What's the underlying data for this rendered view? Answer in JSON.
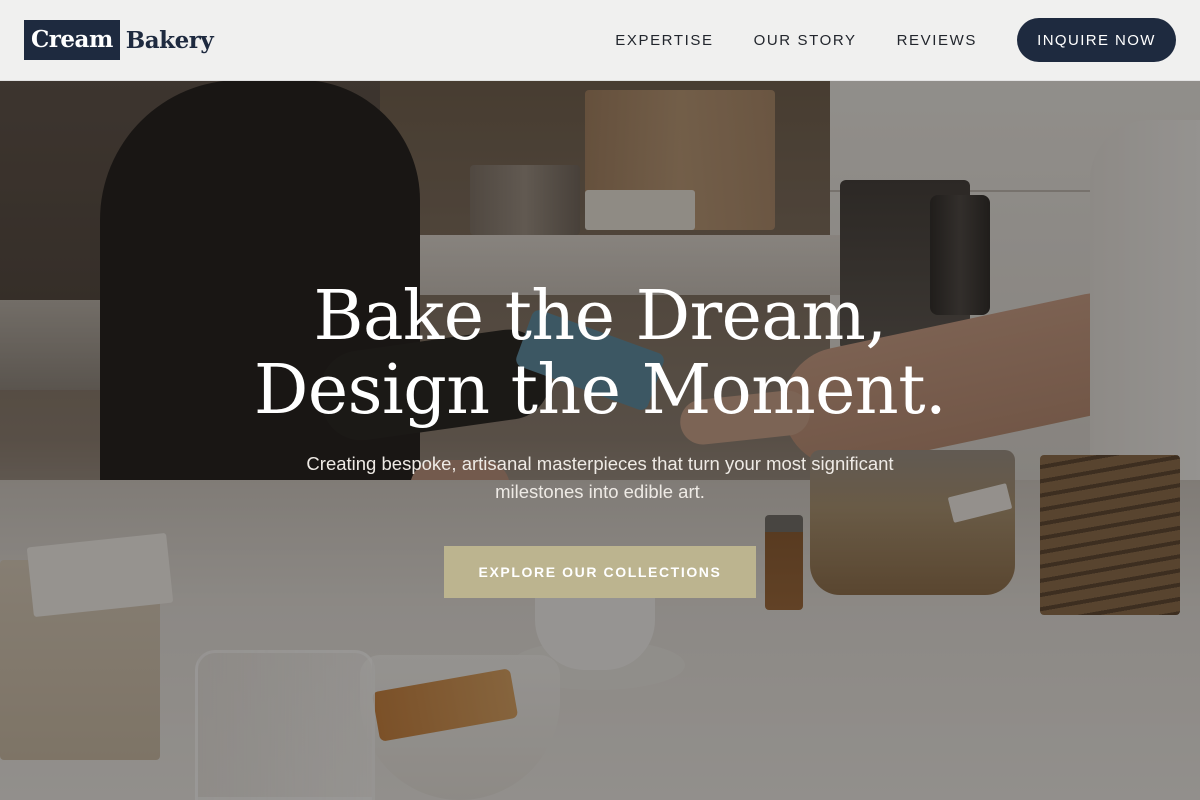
{
  "nav": {
    "logo_highlight": "Cream",
    "logo_word": "Bakery",
    "links": [
      {
        "label": "EXPERTISE"
      },
      {
        "label": "OUR STORY"
      },
      {
        "label": "REVIEWS"
      }
    ],
    "inquire_label": "INQUIRE NOW"
  },
  "hero": {
    "headline_line1": "Bake the Dream,",
    "headline_line2": "Design the Moment.",
    "subtitle": "Creating bespoke, artisanal masterpieces that turn your most significant milestones into edible art.",
    "cta_label": "EXPLORE OUR COLLECTIONS"
  },
  "colors": {
    "brand_navy": "#1e2a3f",
    "cta_khaki": "#bcb48f",
    "nav_background": "#f6f6f6"
  }
}
